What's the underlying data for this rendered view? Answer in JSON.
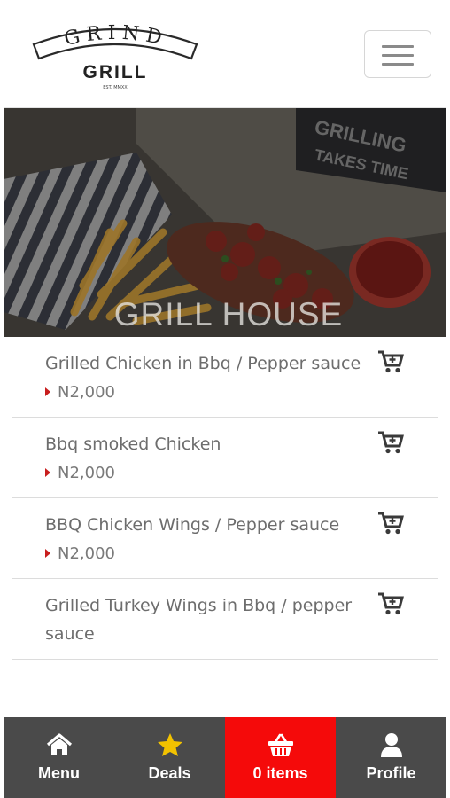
{
  "header": {
    "logo_top_text": "GRIND",
    "logo_bottom_text": "GRILL",
    "logo_small_text": "EST. MMXX",
    "menu_toggle_icon": "hamburger-icon"
  },
  "hero": {
    "title": "GRILL HOUSE",
    "background_text_1": "GRILLING",
    "background_text_2": "TAKES TIME"
  },
  "menu_items": [
    {
      "name": "Grilled Chicken in Bbq / Pepper sauce",
      "price": "N2,000",
      "icon": "add-to-cart-icon"
    },
    {
      "name": "Bbq smoked Chicken",
      "price": "N2,000",
      "icon": "add-to-cart-icon"
    },
    {
      "name": "BBQ Chicken Wings / Pepper sauce",
      "price": "N2,000",
      "icon": "add-to-cart-icon"
    },
    {
      "name": "Grilled Turkey Wings in Bbq / pepper sauce",
      "price": "",
      "icon": "add-to-cart-icon"
    }
  ],
  "bottom_nav": [
    {
      "label": "Menu",
      "icon": "home-icon"
    },
    {
      "label": "Deals",
      "icon": "star-icon"
    },
    {
      "label": "0 items",
      "icon": "basket-icon",
      "active": true
    },
    {
      "label": "Profile",
      "icon": "user-icon"
    }
  ],
  "colors": {
    "accent_red": "#f50a0a",
    "nav_background": "#4a4a4a",
    "star_yellow": "#f2c200",
    "price_caret": "#c81e1e"
  }
}
